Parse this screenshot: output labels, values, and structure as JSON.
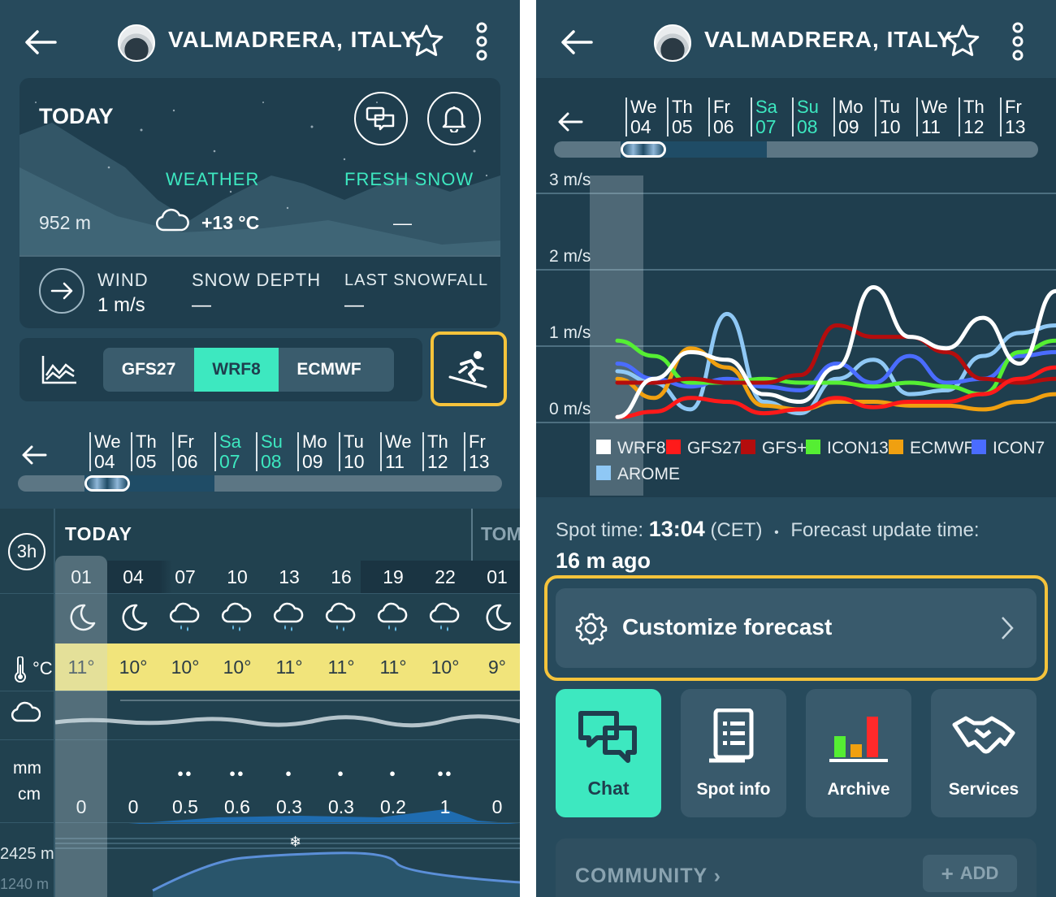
{
  "left": {
    "header": {
      "title": "VALMADRERA, ITALY"
    },
    "today_card": {
      "title": "TODAY",
      "weather_label": "WEATHER",
      "fresh_snow_label": "FRESH SNOW",
      "altitude": "952 m",
      "weather_temp": "+13 °C",
      "fresh_snow_value": "—",
      "wind_label": "WIND",
      "wind_value": "1 m/s",
      "snow_depth_label": "SNOW DEPTH",
      "snow_depth_value": "—",
      "last_snowfall_label": "LAST SNOWFALL",
      "last_snowfall_value": "—"
    },
    "models": {
      "options": [
        "GFS27",
        "WRF8",
        "ECMWF"
      ],
      "selected": "WRF8"
    },
    "days": [
      {
        "dow": "We",
        "num": "04"
      },
      {
        "dow": "Th",
        "num": "05"
      },
      {
        "dow": "Fr",
        "num": "06"
      },
      {
        "dow": "Sa",
        "num": "07"
      },
      {
        "dow": "Su",
        "num": "08"
      },
      {
        "dow": "Mo",
        "num": "09"
      },
      {
        "dow": "Tu",
        "num": "10"
      },
      {
        "dow": "We",
        "num": "11"
      },
      {
        "dow": "Th",
        "num": "12"
      },
      {
        "dow": "Fr",
        "num": "13"
      }
    ],
    "forecast": {
      "interval": "3h",
      "today_label": "TODAY",
      "tomorrow_label": "TOM",
      "temp_unit": "°C",
      "precip_unit_mm": "mm",
      "precip_unit_cm": "cm",
      "freezing_level": "2425 m",
      "freezing_level_next": "1240 m",
      "times": [
        "01",
        "04",
        "07",
        "10",
        "13",
        "16",
        "19",
        "22",
        "01"
      ],
      "icons": [
        "moon-icon",
        "moon-icon",
        "rain-cloud-icon",
        "rain-cloud-icon",
        "rain-cloud-icon",
        "rain-cloud-icon",
        "rain-cloud-icon",
        "rain-cloud-icon",
        "moon-icon"
      ],
      "temps": [
        "11°",
        "10°",
        "10°",
        "10°",
        "11°",
        "11°",
        "11°",
        "10°",
        "9°"
      ],
      "precip": [
        "0",
        "0",
        "0.5",
        "0.6",
        "0.3",
        "0.3",
        "0.2",
        "1",
        "0"
      ]
    }
  },
  "right": {
    "header": {
      "title": "VALMADRERA, ITALY"
    },
    "days": [
      {
        "dow": "We",
        "num": "04"
      },
      {
        "dow": "Th",
        "num": "05"
      },
      {
        "dow": "Fr",
        "num": "06"
      },
      {
        "dow": "Sa",
        "num": "07"
      },
      {
        "dow": "Su",
        "num": "08"
      },
      {
        "dow": "Mo",
        "num": "09"
      },
      {
        "dow": "Tu",
        "num": "10"
      },
      {
        "dow": "We",
        "num": "11"
      },
      {
        "dow": "Th",
        "num": "12"
      },
      {
        "dow": "Fr",
        "num": "13"
      }
    ],
    "meta": {
      "spot_time_label": "Spot time:",
      "spot_time": "13:04",
      "tz": "(CET)",
      "sep": "•",
      "update_label": "Forecast update time:",
      "update_value": "16 m ago"
    },
    "customize_label": "Customize forecast",
    "tiles": [
      {
        "label": "Chat",
        "icon": "chat-icon",
        "active": true
      },
      {
        "label": "Spot info",
        "icon": "document-icon",
        "active": false
      },
      {
        "label": "Archive",
        "icon": "bar-chart-icon",
        "active": false
      },
      {
        "label": "Services",
        "icon": "handshake-icon",
        "active": false
      }
    ],
    "community": {
      "title": "COMMUNITY",
      "add_label": "ADD"
    }
  },
  "chart_data": {
    "type": "line",
    "title": "",
    "ylabel": "",
    "y_tick_labels": [
      "0 m/s",
      "1 m/s",
      "2 m/s",
      "3 m/s"
    ],
    "ylim": [
      0,
      3
    ],
    "x_range_hours": [
      0,
      36
    ],
    "grid": true,
    "legend_position": "bottom",
    "series": [
      {
        "name": "WRF8",
        "color": "#ffffff",
        "x": [
          0,
          3,
          6,
          9,
          12,
          15,
          18,
          21,
          24,
          27,
          30,
          33,
          36
        ],
        "values": [
          0.05,
          0.55,
          0.9,
          0.8,
          0.35,
          0.25,
          0.7,
          1.75,
          1.1,
          0.95,
          1.35,
          0.75,
          1.7
        ]
      },
      {
        "name": "GFS27",
        "color": "#ff1a1a",
        "x": [
          0,
          3,
          6,
          9,
          12,
          15,
          18,
          21,
          24,
          27,
          30,
          33,
          36
        ],
        "values": [
          0.05,
          0.12,
          0.3,
          0.25,
          0.1,
          0.15,
          0.3,
          0.18,
          0.25,
          0.25,
          0.35,
          0.55,
          0.7
        ]
      },
      {
        "name": "GFS+",
        "color": "#b40d0d",
        "x": [
          0,
          3,
          6,
          9,
          12,
          15,
          18,
          21,
          24,
          27,
          30,
          33,
          36
        ],
        "values": [
          0.5,
          0.5,
          0.55,
          0.5,
          0.5,
          0.6,
          1.25,
          1.1,
          1.1,
          0.9,
          0.55,
          0.5,
          0.55
        ]
      },
      {
        "name": "ICON13",
        "color": "#55ee33",
        "x": [
          0,
          3,
          6,
          9,
          12,
          15,
          18,
          21,
          24,
          27,
          30,
          33,
          36
        ],
        "values": [
          1.05,
          0.85,
          0.5,
          0.5,
          0.55,
          0.5,
          0.5,
          0.45,
          0.5,
          0.45,
          0.35,
          0.9,
          1.05
        ]
      },
      {
        "name": "ECMWF",
        "color": "#f0a010",
        "x": [
          0,
          3,
          6,
          9,
          12,
          15,
          18,
          21,
          24,
          27,
          30,
          33,
          36
        ],
        "values": [
          0.55,
          0.3,
          0.95,
          0.7,
          0.2,
          0.15,
          0.25,
          0.25,
          0.2,
          0.2,
          0.15,
          0.25,
          0.35
        ]
      },
      {
        "name": "ICON7",
        "color": "#4a6cff",
        "x": [
          0,
          3,
          6,
          9,
          12,
          15,
          18,
          21,
          24,
          27,
          30,
          33,
          36
        ],
        "values": [
          0.75,
          0.55,
          0.45,
          0.55,
          0.45,
          0.4,
          0.75,
          0.5,
          0.85,
          0.5,
          0.55,
          0.85,
          0.9
        ]
      },
      {
        "name": "AROME",
        "color": "#8fc8f5",
        "x": [
          0,
          3,
          6,
          9,
          12,
          15,
          18,
          21,
          24,
          27,
          30,
          33,
          36
        ],
        "values": [
          0.65,
          0.5,
          0.15,
          1.4,
          0.25,
          0.1,
          0.55,
          0.8,
          0.35,
          0.4,
          0.85,
          1.15,
          1.25
        ]
      }
    ]
  }
}
